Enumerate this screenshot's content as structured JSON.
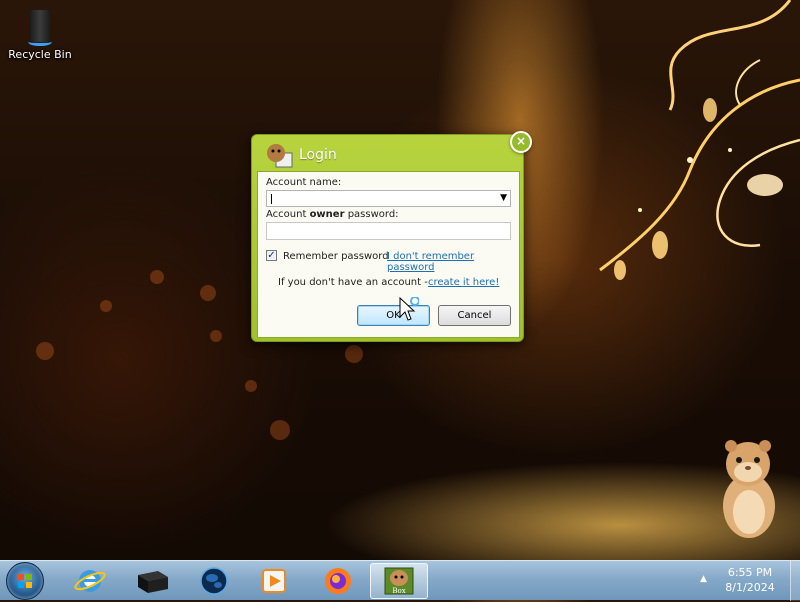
{
  "desktop": {
    "icons": [
      {
        "label": "Recycle Bin",
        "icon": "recycle-bin-icon"
      }
    ]
  },
  "dialog": {
    "title": "Login",
    "account_name_label": "Account name:",
    "account_name_value": "",
    "password_label_prefix": "Account ",
    "password_label_bold": "owner",
    "password_label_suffix": " password:",
    "password_value": "",
    "remember_label": "Remember password",
    "remember_checked": true,
    "forgot_link": "I don't remember password",
    "no_account_text": "If you don't have an account -",
    "create_link": "create it here!",
    "ok_label": "OK",
    "cancel_label": "Cancel",
    "close_icon": "close-icon"
  },
  "taskbar": {
    "items": [
      {
        "name": "start-button",
        "icon": "windows-logo-icon"
      },
      {
        "name": "internet-explorer",
        "icon": "internet-explorer-icon"
      },
      {
        "name": "black-box-app",
        "icon": "black-box-icon"
      },
      {
        "name": "globe-app",
        "icon": "globe-icon"
      },
      {
        "name": "media-player",
        "icon": "media-player-icon"
      },
      {
        "name": "firefox",
        "icon": "firefox-icon"
      },
      {
        "name": "box-app",
        "icon": "hamster-box-icon",
        "active": true,
        "label": "Box"
      }
    ],
    "tray_arrow": "▲",
    "time": "6:55 PM",
    "date": "8/1/2024"
  }
}
